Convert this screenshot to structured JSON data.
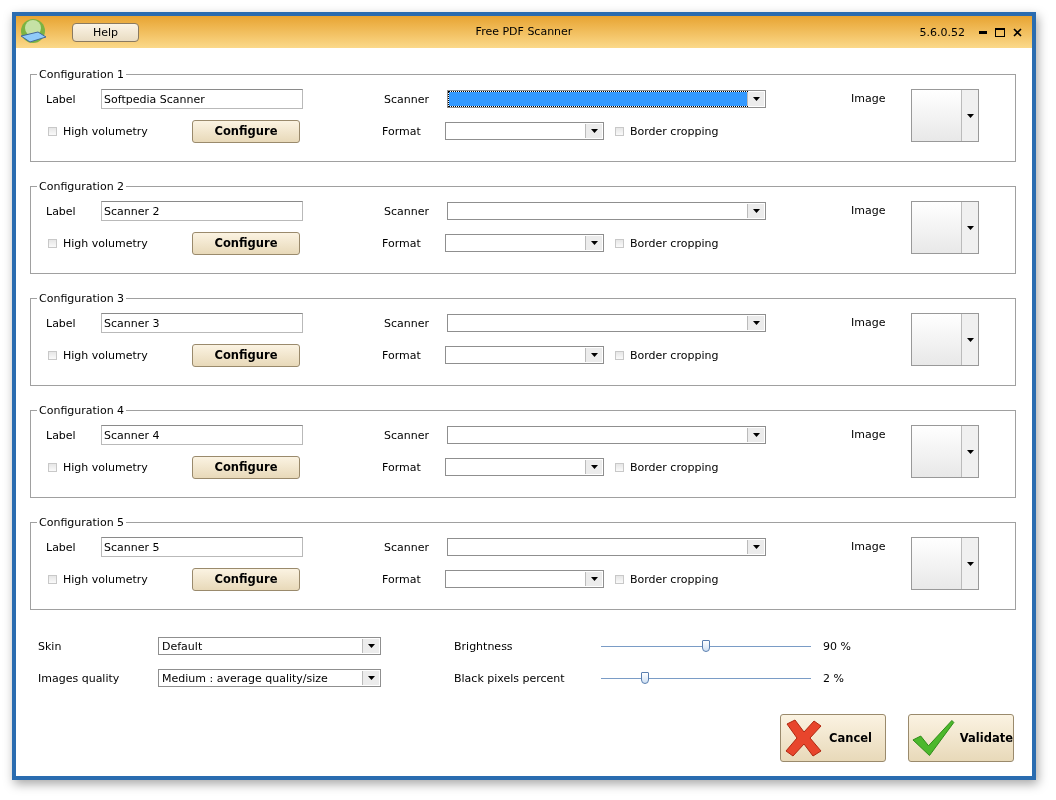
{
  "window": {
    "title": "Free PDF Scanner",
    "version": "5.6.0.52",
    "help_button": "Help"
  },
  "configurations": [
    {
      "title": "Configuration 1",
      "label_caption": "Label",
      "label_value": "Softpedia Scanner",
      "scanner_caption": "Scanner",
      "scanner_focused": true,
      "format_caption": "Format",
      "high_volumetry": {
        "label": "High volumetry",
        "checked": false
      },
      "configure_button": "Configure",
      "border_cropping": {
        "label": "Border cropping",
        "checked": false
      },
      "image_caption": "Image"
    },
    {
      "title": "Configuration 2",
      "label_caption": "Label",
      "label_value": "Scanner 2",
      "scanner_caption": "Scanner",
      "scanner_focused": false,
      "format_caption": "Format",
      "high_volumetry": {
        "label": "High volumetry",
        "checked": false
      },
      "configure_button": "Configure",
      "border_cropping": {
        "label": "Border cropping",
        "checked": false
      },
      "image_caption": "Image"
    },
    {
      "title": "Configuration 3",
      "label_caption": "Label",
      "label_value": "Scanner 3",
      "scanner_caption": "Scanner",
      "scanner_focused": false,
      "format_caption": "Format",
      "high_volumetry": {
        "label": "High volumetry",
        "checked": false
      },
      "configure_button": "Configure",
      "border_cropping": {
        "label": "Border cropping",
        "checked": false
      },
      "image_caption": "Image"
    },
    {
      "title": "Configuration 4",
      "label_caption": "Label",
      "label_value": "Scanner 4",
      "scanner_caption": "Scanner",
      "scanner_focused": false,
      "format_caption": "Format",
      "high_volumetry": {
        "label": "High volumetry",
        "checked": false
      },
      "configure_button": "Configure",
      "border_cropping": {
        "label": "Border cropping",
        "checked": false
      },
      "image_caption": "Image"
    },
    {
      "title": "Configuration 5",
      "label_caption": "Label",
      "label_value": "Scanner 5",
      "scanner_caption": "Scanner",
      "scanner_focused": false,
      "format_caption": "Format",
      "high_volumetry": {
        "label": "High volumetry",
        "checked": false
      },
      "configure_button": "Configure",
      "border_cropping": {
        "label": "Border cropping",
        "checked": false
      },
      "image_caption": "Image"
    }
  ],
  "settings": {
    "skin": {
      "label": "Skin",
      "value": "Default"
    },
    "images_quality": {
      "label": "Images quality",
      "value": "Medium : average quality/size"
    }
  },
  "sliders": [
    {
      "label": "Brightness",
      "level": 0.5,
      "reading": "90 %"
    },
    {
      "label": "Black pixels percent",
      "level": 0.21,
      "reading": "2 %"
    }
  ],
  "buttons": [
    {
      "label": "Cancel",
      "kind": "cancel"
    },
    {
      "label": "Validate",
      "kind": "validate"
    }
  ]
}
